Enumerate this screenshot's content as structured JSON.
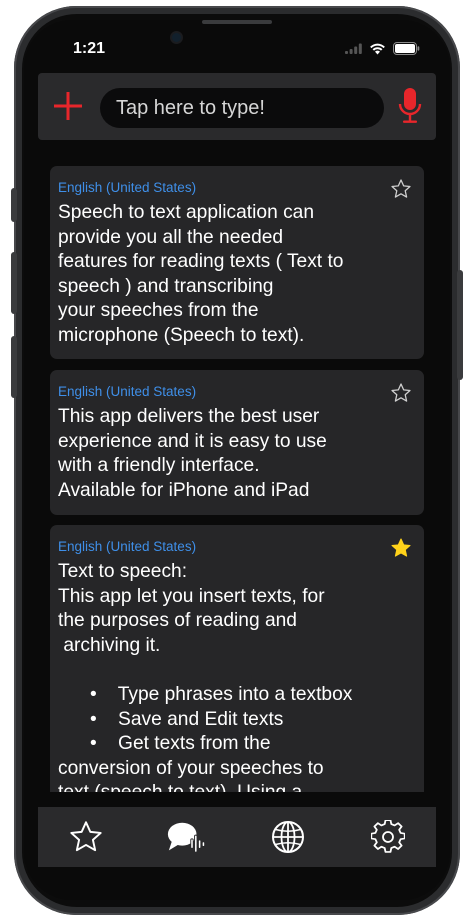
{
  "status": {
    "time": "1:21"
  },
  "search": {
    "placeholder": "Tap here to type!"
  },
  "colors": {
    "accent_red": "#e8262b",
    "link_blue": "#3f8fe8",
    "star_gold": "#ffd21a",
    "card_bg": "#262628",
    "bar_bg": "#2a2a2c"
  },
  "cards": [
    {
      "language": "English (United States)",
      "text": "Speech to text application can\nprovide you all the needed\nfeatures for reading texts ( Text to\nspeech ) and transcribing\nyour speeches from the\nmicrophone (Speech to text).",
      "favorite": false
    },
    {
      "language": "English (United States)",
      "text": "This app delivers the best user\nexperience and it is easy to use\nwith a friendly interface.\nAvailable for iPhone and iPad",
      "favorite": false
    },
    {
      "language": "English (United States)",
      "text": "Text to speech:\nThis app let you insert texts, for\nthe purposes of reading and\n archiving it.\n\n      •    Type phrases into a textbox\n      •    Save and Edit texts\n      •    Get texts from the\nconversion of your speeches to\ntext (speech to text). Using a",
      "favorite": true
    }
  ],
  "tabs": [
    {
      "icon": "star-icon"
    },
    {
      "icon": "speech-bubble-icon"
    },
    {
      "icon": "globe-icon"
    },
    {
      "icon": "gear-icon"
    }
  ]
}
